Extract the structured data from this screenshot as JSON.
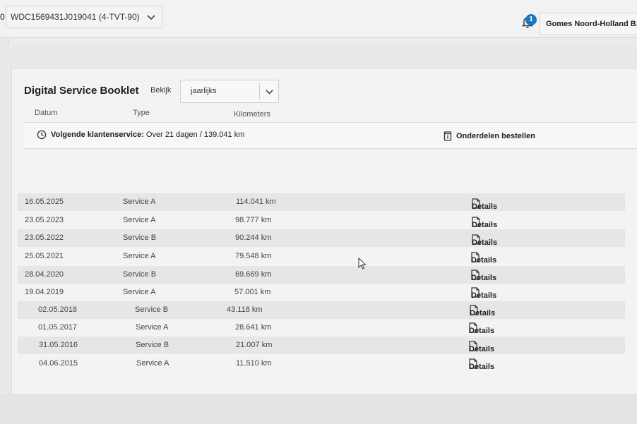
{
  "header": {
    "vin_prefix": "0",
    "vehicle_select": "WDC1569431J019041 (4-TVT-90)",
    "notification_count": "1",
    "dealer_name": "Gomes Noord-Holland B.V"
  },
  "page": {
    "title": "Digital Service Booklet",
    "view_label": "Bekijk",
    "view_value": "jaarlijks"
  },
  "service_bar": {
    "next_label": "Volgende klantenservice:",
    "next_value": "Over 21 dagen / 139.041 km",
    "parts_label": "Onderdelen bestellen"
  },
  "table": {
    "columns": [
      "Datum",
      "Type",
      "Kilometers"
    ],
    "details_label": "Details",
    "rows": [
      {
        "date": "16.05.2025",
        "type": "Service A",
        "km": "114.041 km"
      },
      {
        "date": "23.05.2023",
        "type": "Service A",
        "km": "98.777 km"
      },
      {
        "date": "23.05.2022",
        "type": "Service B",
        "km": "90.244 km"
      },
      {
        "date": "25.05.2021",
        "type": "Service A",
        "km": "79.548 km"
      },
      {
        "date": "28.04.2020",
        "type": "Service B",
        "km": "69.669 km"
      },
      {
        "date": "19.04.2019",
        "type": "Service A",
        "km": "57.001 km"
      },
      {
        "date": "02.05.2018",
        "type": "Service B",
        "km": "43.118 km"
      },
      {
        "date": "01.05.2017",
        "type": "Service A",
        "km": "28.641 km"
      },
      {
        "date": "31.05.2016",
        "type": "Service B",
        "km": "21.007 km"
      },
      {
        "date": "04.06.2015",
        "type": "Service A",
        "km": "11.510 km"
      }
    ]
  },
  "icons": {
    "vehicle_dropdown": "chevron-down-icon",
    "notifications": "bell-icon",
    "view_dropdown": "chevron-down-icon",
    "next_service": "clock-icon",
    "parts": "trash-bin-icon",
    "details": "document-icon"
  },
  "colors": {
    "badge": "#1778c6",
    "row_alt": "#e6e6e6"
  }
}
